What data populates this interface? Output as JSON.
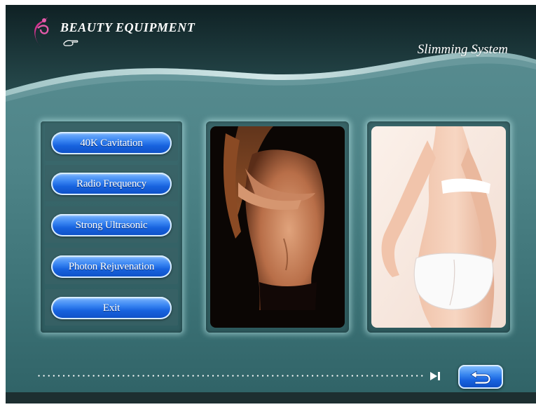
{
  "brand": {
    "name": "BEAUTY EQUIPMENT",
    "logo_icon": "flower-swirl-icon",
    "hand_icon": "pointing-hand-icon"
  },
  "header": {
    "subtitle": "Slimming System"
  },
  "menu": {
    "items": [
      {
        "label": "40K Cavitation"
      },
      {
        "label": "Radio Frequency"
      },
      {
        "label": "Strong Ultrasonic"
      },
      {
        "label": "Photon Rejuvenation"
      },
      {
        "label": "Exit"
      }
    ]
  },
  "images": {
    "left": "woman-front-torso-photo",
    "right": "woman-back-figure-photo"
  },
  "footer": {
    "progress_icon": "skip-to-end-icon",
    "back_icon": "return-arrow-icon"
  },
  "colors": {
    "background": "#4e8488",
    "header_dark": "#1b3336",
    "button_blue": "#1762de",
    "logo_pink": "#d0348f"
  }
}
